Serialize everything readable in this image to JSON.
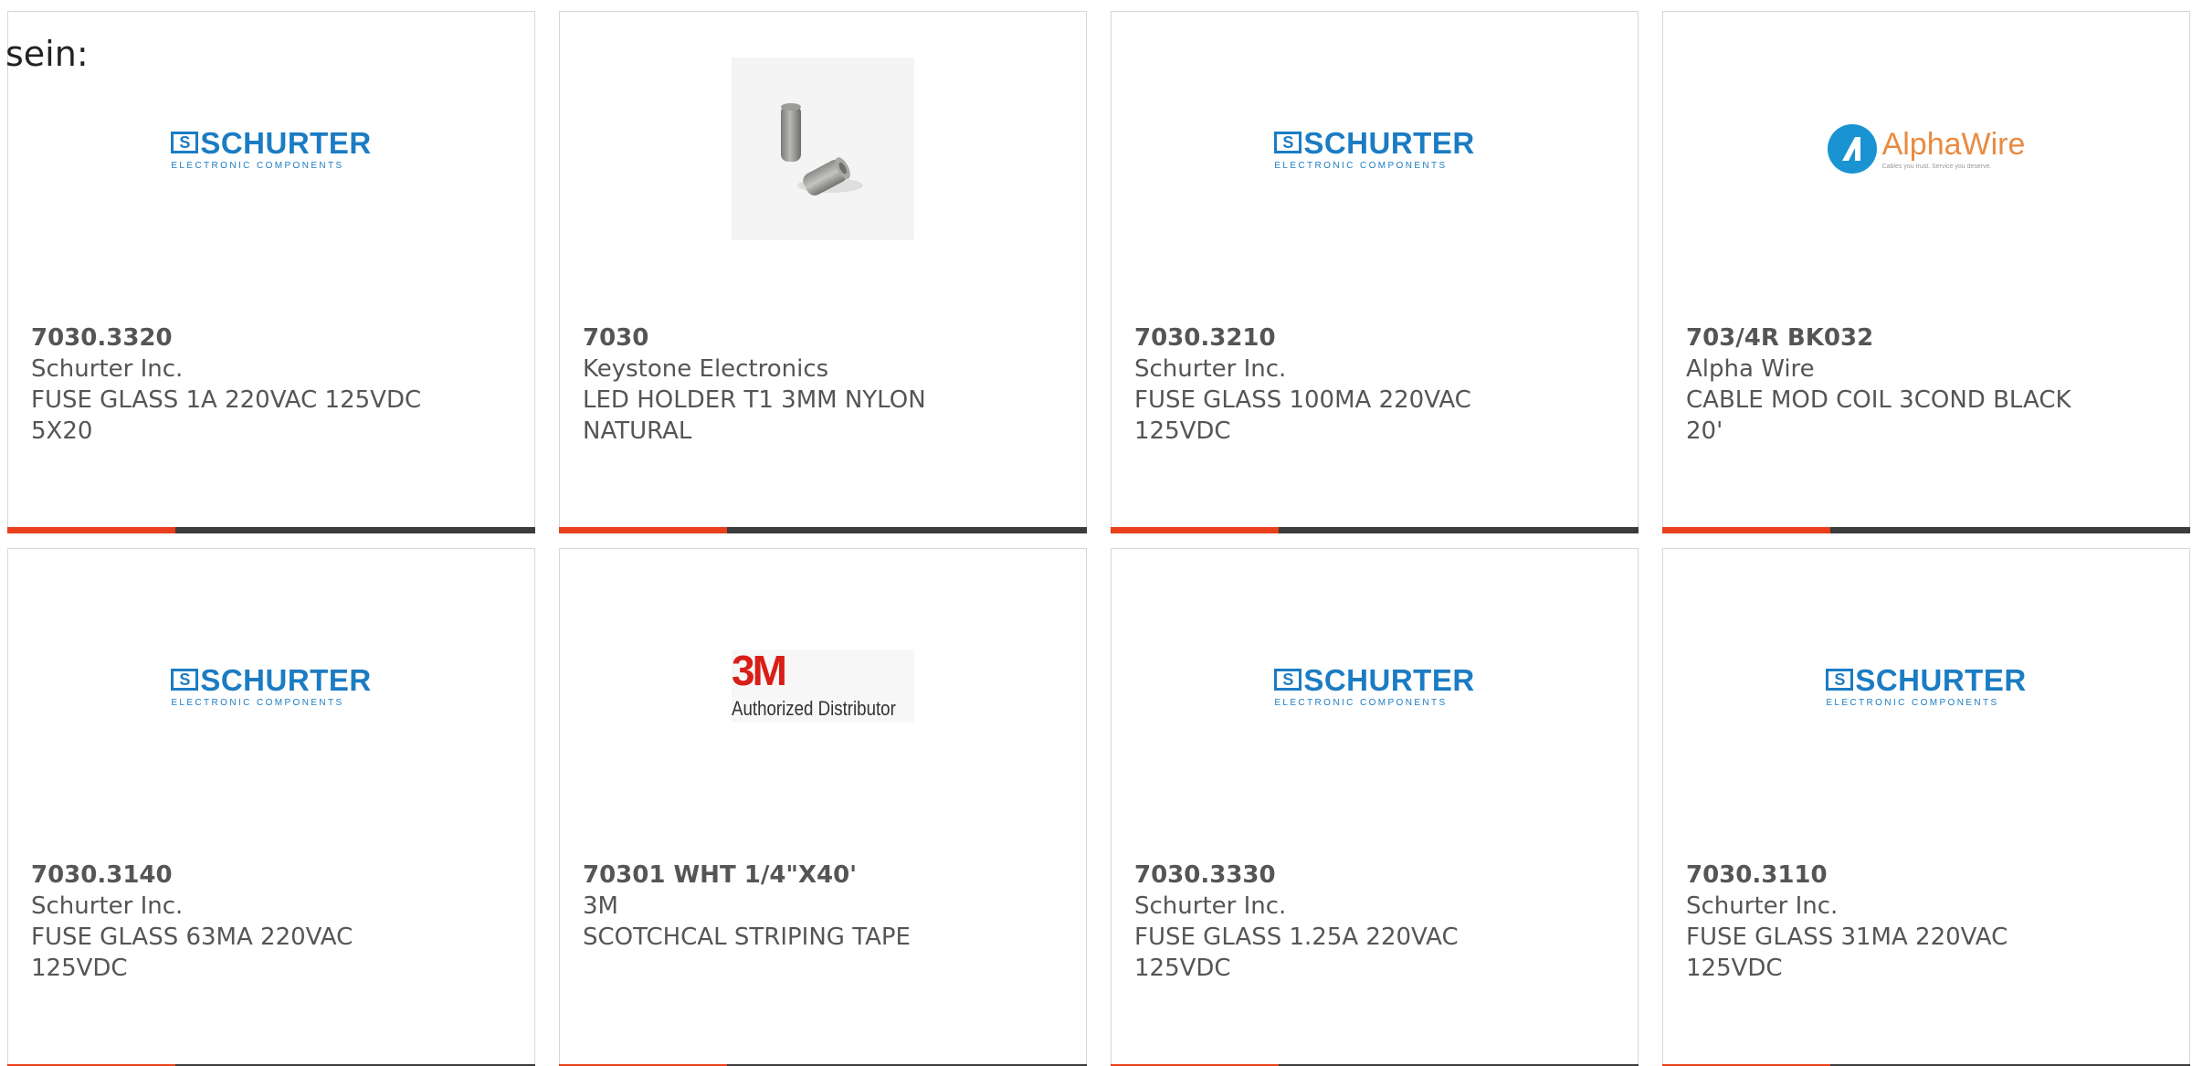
{
  "intro_text": "sein:",
  "colors": {
    "accent": "#e8401c",
    "bar_dark": "#3c3c3c",
    "schurter_blue": "#1b7cc3",
    "alphawire_blue": "#1a93d2",
    "alphawire_orange": "#e98a3f",
    "threem_red": "#d91e18"
  },
  "logos": {
    "schurter": {
      "badge": "S",
      "name": "SCHURTER",
      "subtitle": "ELECTRONIC COMPONENTS"
    },
    "alphawire": {
      "name": "AlphaWire",
      "tagline": "Cables you trust. Service you deserve."
    },
    "threem": {
      "mark": "3M",
      "tagline": "Authorized Distributor"
    }
  },
  "products": [
    {
      "part_number": "7030.3320",
      "manufacturer": "Schurter Inc.",
      "description": "FUSE GLASS 1A 220VAC 125VDC 5X20",
      "logo": "schurter"
    },
    {
      "part_number": "7030",
      "manufacturer": "Keystone Electronics",
      "description": "LED HOLDER T1 3MM NYLON NATURAL",
      "logo": "photo"
    },
    {
      "part_number": "7030.3210",
      "manufacturer": "Schurter Inc.",
      "description": "FUSE GLASS 100MA 220VAC 125VDC",
      "logo": "schurter"
    },
    {
      "part_number": "703/4R BK032",
      "manufacturer": "Alpha Wire",
      "description": "CABLE MOD COIL 3COND BLACK 20'",
      "logo": "alphawire"
    },
    {
      "part_number": "7030.3140",
      "manufacturer": "Schurter Inc.",
      "description": "FUSE GLASS 63MA 220VAC 125VDC",
      "logo": "schurter"
    },
    {
      "part_number": "70301 WHT 1/4\"X40'",
      "manufacturer": "3M",
      "description": "SCOTCHCAL STRIPING TAPE",
      "logo": "threem"
    },
    {
      "part_number": "7030.3330",
      "manufacturer": "Schurter Inc.",
      "description": "FUSE GLASS 1.25A 220VAC 125VDC",
      "logo": "schurter"
    },
    {
      "part_number": "7030.3110",
      "manufacturer": "Schurter Inc.",
      "description": "FUSE GLASS 31MA 220VAC 125VDC",
      "logo": "schurter"
    }
  ]
}
